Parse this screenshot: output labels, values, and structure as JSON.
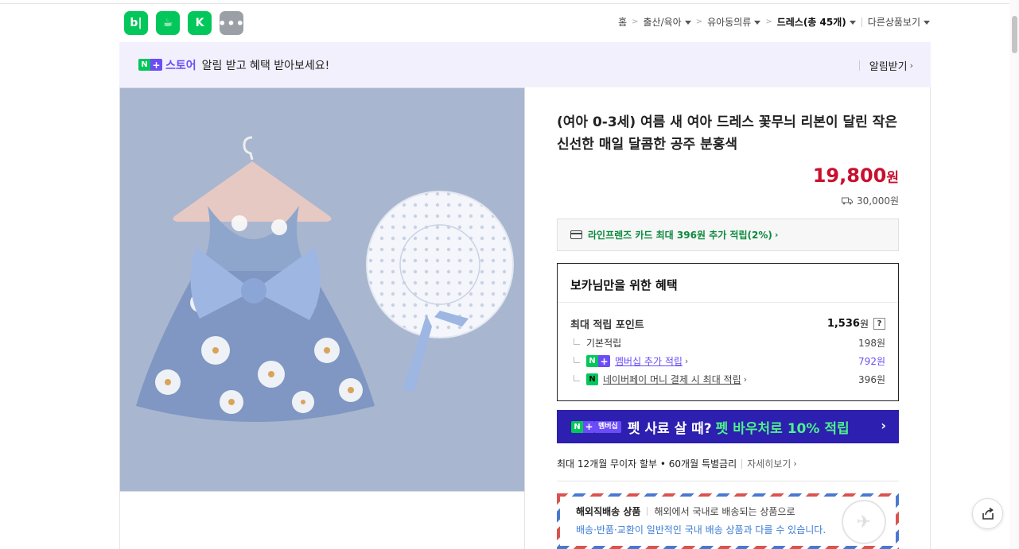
{
  "apps": [
    {
      "name": "blog-app-icon",
      "glyph": "b|",
      "color": "#03c75a"
    },
    {
      "name": "cafe-app-icon",
      "glyph": "☕",
      "color": "#03c75a"
    },
    {
      "name": "kin-app-icon",
      "glyph": "K",
      "color": "#03c75a"
    },
    {
      "name": "more-apps-icon",
      "glyph": "•••",
      "color": "#9aa0a6"
    }
  ],
  "breadcrumb": {
    "home": "홈",
    "cat1": "출산/육아",
    "cat2": "유아동의류",
    "current": "드레스(총 45개)",
    "other": "다른상품보기"
  },
  "banner": {
    "n": "N",
    "plus": "+",
    "store": "스토어",
    "message": "알림 받고 혜택 받아보세요!",
    "action": "알림받기"
  },
  "product": {
    "title": "(여아 0-3세) 여름 새 여아 드레스 꽃무늬 리본이 달린 작은 신선한 매일 달콤한 공주 분홍색",
    "price": "19,800",
    "price_unit": "원",
    "shipping": "30,000원"
  },
  "card_offer": "라인프렌즈 카드 최대 396원 추가 적립(2%)",
  "benefits": {
    "title": "보카님만을 위한 혜택",
    "max_points_label": "최대 적립 포인트",
    "max_points_value": "1,536",
    "max_points_unit": "원",
    "help": "?",
    "base_label": "기본적립",
    "base_value": "198원",
    "membership_label": "멤버십 추가 적립",
    "membership_value": "792원",
    "npay_label": "네이버페이 머니 결제 시 최대 적립",
    "npay_value": "396원"
  },
  "promo": {
    "badge": "멤버십",
    "text": "펫 사료 살 때?",
    "highlight": "펫 바우처로 10% 적립"
  },
  "installment": {
    "text": "최대 12개월 무이자 할부 • 60개월 특별금리",
    "more": "자세히보기"
  },
  "overseas": {
    "label": "해외직배송 상품",
    "desc": "해외에서 국내로 배송되는 상품으로",
    "notice": "배송·반품·교환이 일반적인 국내 배송 상품과 다를 수 있습니다."
  },
  "colors": {
    "price": "#c8102e",
    "naver_green": "#03c75a",
    "store_purple": "#6b4cf6",
    "promo_bg": "#2d1fb0"
  }
}
